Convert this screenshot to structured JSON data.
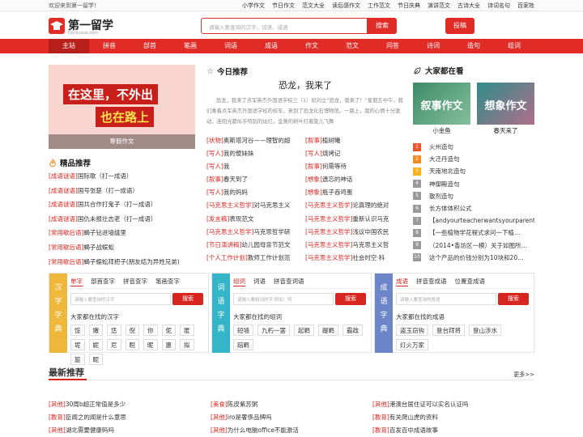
{
  "topbar": {
    "welcome": "欢迎来到第一留学！",
    "links": [
      "小学作文",
      "节日作文",
      "范文大全",
      "读后感作文",
      "工作范文",
      "节日庆典",
      "演讲范文",
      "古诗大全",
      "诗词名句",
      "百家姓"
    ]
  },
  "logo": {
    "name": "第一留学",
    "domain": "Diyiliuxue.com"
  },
  "search": {
    "placeholder": "请输入要查询的汉字，词语，成语",
    "button": "搜索",
    "tougao": "投稿"
  },
  "nav": [
    "主站",
    "拼音",
    "部首",
    "笔画",
    "词语",
    "成语",
    "作文",
    "范文",
    "问答",
    "诗词",
    "造句",
    "组词"
  ],
  "banner": {
    "line1": "在这里，不外出",
    "line2": "也在路上",
    "caption": "寒假作文"
  },
  "jingpin": {
    "title": "精品推荐",
    "items": [
      {
        "tag": "[成语谜语]",
        "text": "国际歌（打一成语）"
      },
      {
        "tag": "[成语谜语]",
        "text": "国号张楚（打一成语）"
      },
      {
        "tag": "[成语谜语]",
        "text": "国共合作打鬼子（打一成语）"
      },
      {
        "tag": "[成语谜语]",
        "text": "国仇未报壮志老（打一成语）"
      },
      {
        "tag": "[常用歇后语]",
        "text": "蝎子钻进墙缝里"
      },
      {
        "tag": "[常用歇后语]",
        "text": "蝎子战蜈蚣"
      },
      {
        "tag": "[常用歇后语]",
        "text": "蝎子蜈蚣拜把子(朋友结为异姓兄弟)"
      }
    ]
  },
  "today": {
    "title": "今日推荐",
    "article_title": "恐龙，我来了",
    "excerpt": "恐龙，我来了点军英杰外国语学校三（1）班刘立“恐龙，我来了！”星期五中午，我们乘着点军英杰外国语学校的校车，来到了恐龙化石博物馆。一路上，我的心情十分激动，连阳光都似乎特别的灿烂，金黄的树叶打着旋儿飞舞",
    "rows": [
      [
        {
          "tag": "[状物]",
          "text": "奥斯塔河谷——理智的超"
        },
        {
          "tag": "[叙事]",
          "text": "植树曦"
        }
      ],
      [
        {
          "tag": "[写人]",
          "text": "我的傻妹妹"
        },
        {
          "tag": "[写人]",
          "text": "烧烤记"
        }
      ],
      [
        {
          "tag": "[写人]",
          "text": "我"
        },
        {
          "tag": "[叙事]",
          "text": "何需等待"
        }
      ],
      [
        {
          "tag": "[叙事]",
          "text": "春天到了"
        },
        {
          "tag": "[想象]",
          "text": "遗忘的神话"
        }
      ],
      [
        {
          "tag": "[写人]",
          "text": "我的妈妈"
        },
        {
          "tag": "[想象]",
          "text": "瓶子吞鸡蛋"
        }
      ],
      [
        {
          "tag": "[马克思主义哲学]",
          "text": "对马克思主义"
        },
        {
          "tag": "[马克思主义哲学]",
          "text": "论真理的绝对"
        }
      ],
      [
        {
          "tag": "[发言稿]",
          "text": "表现范文"
        },
        {
          "tag": "[马克思主义哲学]",
          "text": "重新认识马克"
        }
      ],
      [
        {
          "tag": "[马克思主义哲学]",
          "text": "马克思哲学研"
        },
        {
          "tag": "[马克思主义哲学]",
          "text": "浅议中国农民"
        }
      ],
      [
        {
          "tag": "[节日演讲稿]",
          "text": "幼儿园母亲节范文"
        },
        {
          "tag": "[马克思主义哲学]",
          "text": "马克思主义哲"
        }
      ],
      [
        {
          "tag": "[个人工作计划]",
          "text": "教师工作计划范"
        },
        {
          "tag": "[马克思主义哲学]",
          "text": "社会时空·科"
        }
      ]
    ]
  },
  "watch": {
    "title": "大家都在看",
    "pics": [
      {
        "img_text": "叙事作文",
        "caption": "小金鱼"
      },
      {
        "img_text": "想象作文",
        "caption": "春天来了"
      }
    ],
    "ranks": [
      "火州造句",
      "大迁丹造句",
      "天南地北造句",
      "神御殿造句",
      "散剂造句",
      "长方体体积公式",
      "【andyourteacherwantsyourparentst…",
      "【一些植物学花程式求问一下植…",
      "（2014•香坊区一模）关于如图所…",
      "这个产品的价钱分别为10块和20…"
    ],
    "rank_colors": [
      "#e9562b",
      "#f08a24",
      "#f5b21b",
      "#999999",
      "#999999",
      "#999999",
      "#999999",
      "#999999",
      "#999999",
      "#999999"
    ]
  },
  "dict": [
    {
      "side": "汉字字典",
      "color": "#f0b83a",
      "tabs": [
        "单字",
        "部首查字",
        "拼音查字",
        "笔画查字"
      ],
      "placeholder": "请输入要查询的汉字",
      "button": "搜索",
      "sub": "大家都在找的汉字",
      "chips": [
        "馁",
        "嫩",
        "恁",
        "倪",
        "你",
        "伲",
        "匿",
        "坭",
        "妮",
        "尼",
        "睨",
        "昵",
        "惠",
        "拟",
        "旎",
        "昵"
      ]
    },
    {
      "side": "词语字典",
      "color": "#35b6c8",
      "tabs": [
        "组词",
        "词语",
        "拼音查词语"
      ],
      "placeholder": "请输入要组词的字,例如：阿",
      "button": "搜索",
      "sub": "大家都在找的组词",
      "chips": [
        "短墙",
        "九朽一罢",
        "起羁",
        "踶羁",
        "霸政",
        "踣羁"
      ]
    },
    {
      "side": "成语字典",
      "color": "#6c86c9",
      "tabs": [
        "成语",
        "拼音查成语",
        "位置查成语"
      ],
      "placeholder": "请输入要查询的成语",
      "button": "搜索",
      "sub": "大家都在找的成语",
      "chips": [
        "盗玉窃钩",
        "登台拜将",
        "登山涉水",
        "灯火万家"
      ]
    }
  ],
  "latest": {
    "title": "最新推荐",
    "more": "更多>>",
    "rows": [
      [
        {
          "tag": "[其他]",
          "text": "30周b超正常值是多少"
        },
        {
          "tag": "[美食]",
          "text": "陈皮紫苏粥"
        },
        {
          "tag": "[其他]",
          "text": "港澳台居住证可以实名认证吗"
        }
      ],
      [
        {
          "tag": "[教育]",
          "text": "臣闻之的闻是什么意思"
        },
        {
          "tag": "[其他]",
          "text": "iro是奢侈品牌吗"
        },
        {
          "tag": "[教育]",
          "text": "有关爬山虎的资料"
        }
      ],
      [
        {
          "tag": "[其他]",
          "text": "湖北需要健康码吗"
        },
        {
          "tag": "[其他]",
          "text": "为什么电脑office不能激活"
        },
        {
          "tag": "[教育]",
          "text": "百发百中成语故事"
        }
      ]
    ]
  }
}
